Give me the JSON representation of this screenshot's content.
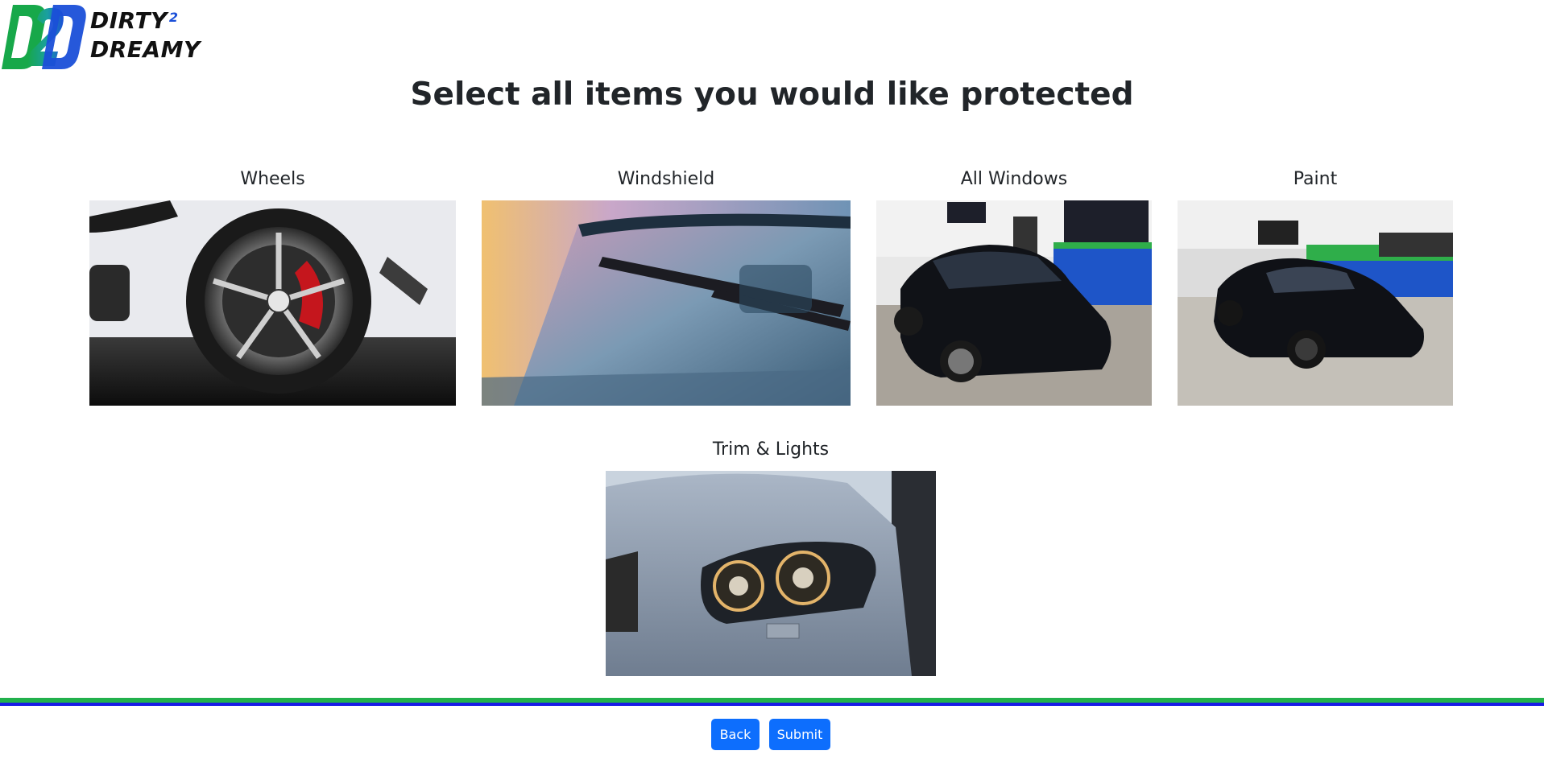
{
  "logo": {
    "mark_text": "D2D",
    "line1": "DIRTY",
    "superscript": "2",
    "line2": "DREAMY"
  },
  "title": "Select all items you would like protected",
  "items": [
    {
      "label": "Wheels"
    },
    {
      "label": "Windshield"
    },
    {
      "label": "All Windows"
    },
    {
      "label": "Paint"
    },
    {
      "label": "Trim & Lights"
    }
  ],
  "buttons": {
    "back": "Back",
    "submit": "Submit"
  },
  "colors": {
    "primary_button": "#0d6efd",
    "footer_green": "#22b14c",
    "footer_blue": "#1a1ae6",
    "logo_green": "#1aa84a",
    "logo_blue": "#1a4fd8"
  }
}
